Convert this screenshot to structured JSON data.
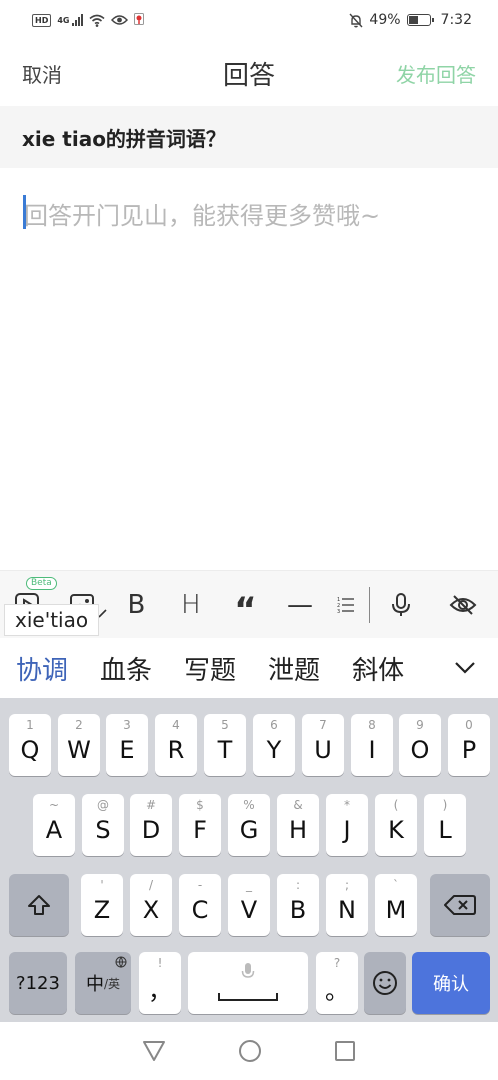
{
  "status_bar": {
    "hd": "HD",
    "network": "4G",
    "battery_percent": "49%",
    "battery_level": 0.49,
    "time": "7:32"
  },
  "header": {
    "cancel": "取消",
    "title": "回答",
    "publish": "发布回答",
    "publish_color": "#8fd4a6"
  },
  "question": "xie tiao的拼音词语？",
  "answer": {
    "value": "",
    "placeholder": "回答开门见山，能获得更多赞哦~"
  },
  "toolbar": {
    "beta_badge": "Beta",
    "bold": "B",
    "heading": "H",
    "quote": "“",
    "divider": "—",
    "items": [
      "video-icon",
      "image-icon",
      "bold-icon",
      "heading-icon",
      "quote-icon",
      "divider-icon",
      "ordered-list-icon",
      "microphone-icon",
      "hide-icon"
    ]
  },
  "composing": "xie'tiao",
  "candidates": [
    "协调",
    "血条",
    "写题",
    "泄题",
    "斜体"
  ],
  "keyboard": {
    "row1": [
      {
        "key": "Q",
        "hint": "1"
      },
      {
        "key": "W",
        "hint": "2"
      },
      {
        "key": "E",
        "hint": "3"
      },
      {
        "key": "R",
        "hint": "4"
      },
      {
        "key": "T",
        "hint": "5"
      },
      {
        "key": "Y",
        "hint": "6"
      },
      {
        "key": "U",
        "hint": "7"
      },
      {
        "key": "I",
        "hint": "8"
      },
      {
        "key": "O",
        "hint": "9"
      },
      {
        "key": "P",
        "hint": "0"
      }
    ],
    "row2": [
      {
        "key": "A",
        "hint": "~"
      },
      {
        "key": "S",
        "hint": "@"
      },
      {
        "key": "D",
        "hint": "#"
      },
      {
        "key": "F",
        "hint": "$"
      },
      {
        "key": "G",
        "hint": "%"
      },
      {
        "key": "H",
        "hint": "&"
      },
      {
        "key": "J",
        "hint": "*"
      },
      {
        "key": "K",
        "hint": "("
      },
      {
        "key": "L",
        "hint": ")"
      }
    ],
    "row3": [
      {
        "key": "Z",
        "hint": "'"
      },
      {
        "key": "X",
        "hint": "/"
      },
      {
        "key": "C",
        "hint": "-"
      },
      {
        "key": "V",
        "hint": "_"
      },
      {
        "key": "B",
        "hint": ":"
      },
      {
        "key": "N",
        "hint": ";"
      },
      {
        "key": "M",
        "hint": "`"
      }
    ],
    "num_key": "?123",
    "lang_key_main": "中",
    "lang_key_sub": "/英",
    "comma_hint": "!",
    "comma": "，",
    "period_hint": "?",
    "period": "。",
    "confirm": "确认",
    "confirm_color": "#4d74dc"
  }
}
